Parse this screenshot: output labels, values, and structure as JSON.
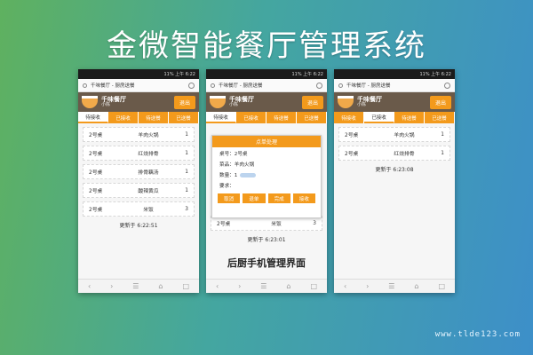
{
  "page_title": "金微智能餐厅管理系统",
  "watermark": "www.tlde123.com",
  "app": {
    "address": "千味餐厅 - 厨房送餐",
    "brand_name": "千味餐厅",
    "user": "小陈",
    "logout": "退出",
    "tabs": [
      "待接收",
      "已接收",
      "待送餐",
      "已送餐"
    ],
    "status": "11% 上午 6:22"
  },
  "screen1": {
    "active_tab": 0,
    "rows": [
      {
        "table": "2号桌",
        "dish": "羊肉火锅",
        "qty": "1"
      },
      {
        "table": "2号桌",
        "dish": "红烧排骨",
        "qty": "1"
      },
      {
        "table": "2号桌",
        "dish": "排骨藕汤",
        "qty": "1"
      },
      {
        "table": "2号桌",
        "dish": "酸辣黄瓜",
        "qty": "1"
      },
      {
        "table": "2号桌",
        "dish": "米饭",
        "qty": "3"
      }
    ],
    "updated": "更新于 6:22:51"
  },
  "screen2": {
    "active_tab": 0,
    "dialog": {
      "title": "点单处理",
      "table": "桌号：2号桌",
      "dish": "菜品：羊肉火锅",
      "qty": "数量：1",
      "note": "要求：",
      "buttons": [
        "取消",
        "退单",
        "完成",
        "接收"
      ]
    },
    "bottom_row": {
      "table": "2号桌",
      "dish": "米饭",
      "qty": "3"
    },
    "updated": "更新于 6:23:01",
    "caption": "后厨手机管理界面"
  },
  "screen3": {
    "active_tab": 1,
    "rows": [
      {
        "table": "2号桌",
        "dish": "羊肉火锅",
        "qty": "1"
      },
      {
        "table": "2号桌",
        "dish": "红烧排骨",
        "qty": "1"
      }
    ],
    "updated": "更新于 6:23:08"
  },
  "nav_icons": [
    "back-icon",
    "forward-icon",
    "menu-icon",
    "home-icon",
    "tabs-icon"
  ],
  "colors": {
    "accent": "#f39a1c",
    "header": "#6a5a4a"
  }
}
